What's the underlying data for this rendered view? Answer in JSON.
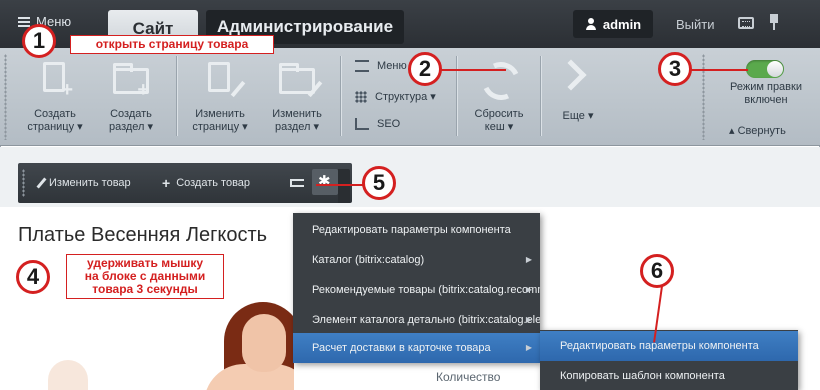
{
  "topbar": {
    "menu_label": "Меню",
    "tab_site": "Сайт",
    "tab_admin": "Администрирование",
    "user_name": "admin",
    "logout": "Выйти"
  },
  "ribbon": {
    "create_page": [
      "Создать",
      "страницу ▾"
    ],
    "create_section": [
      "Создать",
      "раздел ▾"
    ],
    "edit_page": [
      "Изменить",
      "страницу ▾"
    ],
    "edit_section": [
      "Изменить",
      "раздел ▾"
    ],
    "small_menu": "Меню",
    "structure": "Структура ▾",
    "seo": "SEO",
    "reset_cache": [
      "Сбросить",
      "кеш ▾"
    ],
    "more": "Еще ▾",
    "edit_mode": [
      "Режим правки",
      "включен"
    ],
    "collapse": "▴ Свернуть"
  },
  "component_bar": {
    "edit_product": "Изменить товар",
    "create_product": "Создать товар"
  },
  "page": {
    "heading": "Платье Весенняя Легкость",
    "quantity_label": "Количество"
  },
  "menu1": {
    "items": [
      "Редактировать параметры компонента",
      "Каталог (bitrix:catalog)",
      "Рекомендуемые товары (bitrix:catalog.recommended.products)",
      "Элемент каталога детально (bitrix:catalog.element)",
      "Расчет доставки в карточке товара"
    ]
  },
  "menu2": {
    "items": [
      "Редактировать параметры компонента",
      "Копировать шаблон компонента"
    ]
  },
  "annotations": {
    "step1": "1",
    "step1_text": "открыть страницу товара",
    "step2": "2",
    "step3": "3",
    "step4": "4",
    "step4_text": [
      "удерживать мышку",
      "на блоке с данными",
      "товара 3 секунды"
    ],
    "step5": "5",
    "step6": "6",
    "accent_color": "#d42020"
  }
}
